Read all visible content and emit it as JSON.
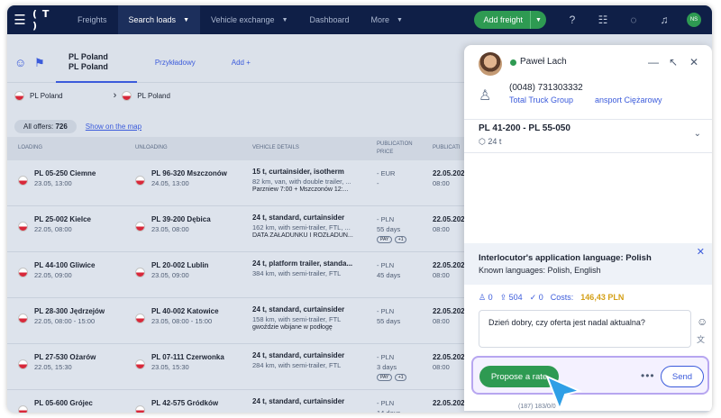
{
  "nav": {
    "logo": "( T )",
    "items": [
      "Freights",
      "Search loads",
      "Vehicle exchange",
      "Dashboard",
      "More"
    ],
    "add_freight": "Add freight",
    "avatar": "NS"
  },
  "tabs": {
    "active_line1": "PL Poland",
    "active_line2": "PL Poland",
    "example": "Przykładowy",
    "add": "Add +"
  },
  "route": {
    "from": "PL Poland",
    "to": "PL Poland"
  },
  "offers": {
    "label": "All offers:",
    "count": "726",
    "show_map": "Show on the map"
  },
  "columns": [
    "Loading",
    "Unloading",
    "Vehicle details",
    "Publication price",
    "Publicati"
  ],
  "rows": [
    {
      "load": "PL 05-250 Ciemne",
      "load_date": "23.05, 13:00",
      "unload": "PL 96-320 Mszczonów",
      "unload_date": "24.05, 13:00",
      "veh1": "15 t, curtainsider, isotherm",
      "veh2": "82 km, van, with double trailer, ...",
      "veh3": "Parzniew 7:00 + Mszczonów 12:...",
      "price1": "- EUR",
      "price2": "-",
      "pub1": "22.05.202",
      "pub2": "08:00"
    },
    {
      "load": "PL 25-002 Kielce",
      "load_date": "22.05, 08:00",
      "unload": "PL 39-200 Dębica",
      "unload_date": "23.05, 08:00",
      "veh1": "24 t, standard, curtainsider",
      "veh2": "162 km, with semi-trailer, FTL, ...",
      "veh3": "DATA ZAŁADUNKU I ROZŁADUN...",
      "price1": "- PLN",
      "price2": "55 days",
      "pub1": "22.05.202",
      "pub2": "08:00",
      "badge": "PAY",
      "badge2": "+1"
    },
    {
      "load": "PL 44-100 Gliwice",
      "load_date": "22.05, 09:00",
      "unload": "PL 20-002 Lublin",
      "unload_date": "23.05, 09:00",
      "veh1": "24 t, platform trailer, standa...",
      "veh2": "384 km, with semi-trailer, FTL",
      "veh3": "",
      "price1": "- PLN",
      "price2": "45 days",
      "pub1": "22.05.202",
      "pub2": "08:00"
    },
    {
      "load": "PL 28-300 Jędrzejów",
      "load_date": "22.05, 08:00 - 15:00",
      "unload": "PL 40-002 Katowice",
      "unload_date": "23.05, 08:00 - 15:00",
      "veh1": "24 t, standard, curtainsider",
      "veh2": "158 km, with semi-trailer, FTL",
      "veh3": "gwoździe wbijane w podłogę",
      "price1": "- PLN",
      "price2": "55 days",
      "pub1": "22.05.202",
      "pub2": "08:00"
    },
    {
      "load": "PL 27-530 Ożarów",
      "load_date": "22.05, 15:30",
      "unload": "PL 07-111 Czerwonka",
      "unload_date": "23.05, 15:30",
      "veh1": "24 t, standard, curtainsider",
      "veh2": "284 km, with semi-trailer, FTL",
      "veh3": "",
      "price1": "- PLN",
      "price2": "3 days",
      "pub1": "22.05.202",
      "pub2": "08:00",
      "badge": "PAY",
      "badge2": "+1"
    },
    {
      "load": "PL 05-600 Grójec",
      "load_date": "",
      "unload": "PL 42-575 Gródków",
      "unload_date": "",
      "veh1": "24 t, standard, curtainsider",
      "veh2": "",
      "veh3": "",
      "price1": "- PLN",
      "price2": "14 days",
      "pub1": "22.05.2025",
      "pub2": ""
    }
  ],
  "panel": {
    "name": "Paweł Lach",
    "phone": "(0048) 731303332",
    "company": "Total Truck Group",
    "company2": "ansport Ciężarowy",
    "route": "PL 41-200 - PL 55-050",
    "weight": "24 t",
    "lang_title": "Interlocutor's application language: Polish",
    "lang_known": "Known languages: Polish, English",
    "stat1": "0",
    "stat2": "504",
    "stat3": "0",
    "costs_label": "Costs:",
    "costs": "146,43 PLN",
    "message": "Dzień dobry, czy oferta jest nadal aktualna?",
    "propose": "Propose a rate",
    "send": "Send",
    "footer": "(187)  183/0/0"
  }
}
